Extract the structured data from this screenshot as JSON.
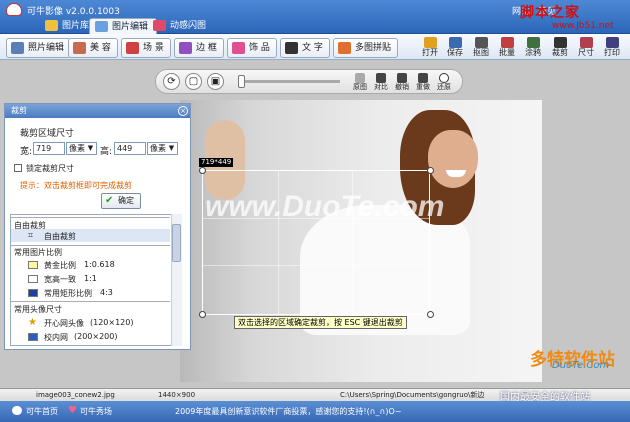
{
  "app": {
    "title": "可牛影像 v2.0.0.1003",
    "top_links": [
      "网站",
      "意见"
    ],
    "watermark_site": "脚本之家",
    "watermark_url": "www.Jb51.net"
  },
  "tabs": [
    {
      "label": "图片库",
      "color": "#f0c040"
    },
    {
      "label": "图片编辑",
      "color": "#6aa0e0"
    },
    {
      "label": "动感闪图",
      "color": "#e04a6a"
    }
  ],
  "toolbar": {
    "left": [
      {
        "label": "照片编辑",
        "color": "#5a7fb8"
      },
      {
        "label": "美 容",
        "color": "#c86a50"
      },
      {
        "label": "场 景",
        "color": "#d04040"
      },
      {
        "label": "边 框",
        "color": "#9050c0"
      },
      {
        "label": "饰 品",
        "color": "#e05090"
      },
      {
        "label": "文 字",
        "color": "#333333"
      },
      {
        "label": "多图拼贴",
        "color": "#e07030"
      }
    ],
    "right": [
      {
        "label": "打开",
        "color": "#e0a020"
      },
      {
        "label": "保存",
        "color": "#3a6ab0"
      },
      {
        "label": "抠图",
        "color": "#555555"
      },
      {
        "label": "批量",
        "color": "#c04040"
      },
      {
        "label": "涂鸦",
        "color": "#407040"
      },
      {
        "label": "裁剪",
        "color": "#333333"
      },
      {
        "label": "尺寸",
        "color": "#b04050"
      },
      {
        "label": "打印",
        "color": "#404080"
      }
    ]
  },
  "view_controls": {
    "zoom_labels": [
      "原图",
      "对比",
      "撤销",
      "重做",
      "还原"
    ],
    "zoom_level": 0.02
  },
  "crop_overlay": {
    "size": "719*449",
    "hint": "双击选择的区域确定裁剪，按 ESC 键退出裁剪"
  },
  "photo": {
    "watermark": "www.DuoTe.com"
  },
  "crop_panel": {
    "header": "裁剪",
    "section_title": "裁剪区域尺寸",
    "width_label": "宽:",
    "width_value": "719",
    "width_unit": "像素",
    "height_label": "高:",
    "height_value": "449",
    "height_unit": "像素",
    "lock_label": "锁定裁剪尺寸",
    "tip": "提示：双击裁剪框即可完成裁剪",
    "confirm": "确定",
    "list": {
      "sec1": "自由裁剪",
      "item_free": "自由裁剪",
      "sec2": "常用图片比例",
      "item_golden": "黄金比例",
      "ratio_golden": "1:0.618",
      "item_square": "宽高一致",
      "ratio_square": "1:1",
      "item_rect": "常用矩形比例",
      "ratio_rect": "4:3",
      "sec3": "常用头像尺寸",
      "item_kaixin": "开心网头像",
      "size_kaixin": "(120×120)",
      "item_xiaonei": "校内网",
      "size_xiaonei": "(200×200)"
    }
  },
  "status": {
    "filename": "image003_conew2.jpg",
    "dimensions": "1440×900",
    "path": "C:\\Users\\Spring\\Documents\\gongruo\\新边"
  },
  "footer": {
    "home": "可牛首页",
    "show": "可牛秀场",
    "message": "2009年度最具创新意识软件厂商投票，感谢您的支持!(∩_∩)O~",
    "logo_main": "多特软件站",
    "logo_sub": "DuoTe.Com",
    "logo_tag": "国内最安全的软件站"
  }
}
